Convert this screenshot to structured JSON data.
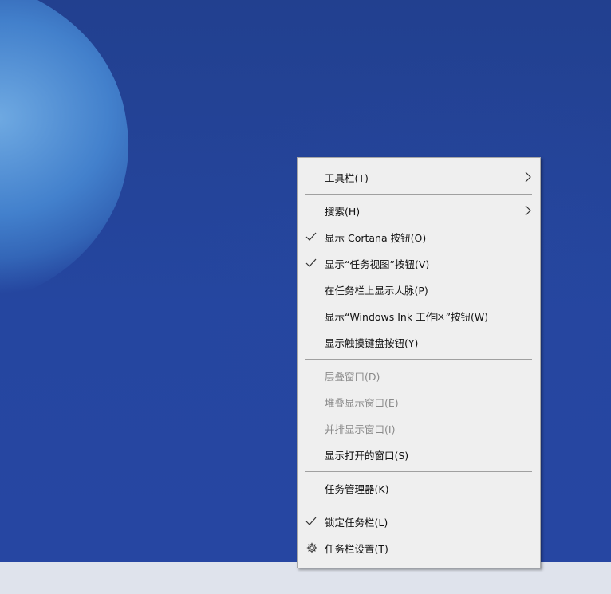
{
  "menu": {
    "toolbars": "工具栏(T)",
    "search": "搜索(H)",
    "show_cortana": "显示 Cortana 按钮(O)",
    "show_task_view": "显示“任务视图”按钮(V)",
    "show_people": "在任务栏上显示人脉(P)",
    "show_ink_workspace": "显示“Windows Ink 工作区”按钮(W)",
    "show_touch_keyboard": "显示触摸键盘按钮(Y)",
    "cascade_windows": "层叠窗口(D)",
    "stack_windows": "堆叠显示窗口(E)",
    "side_by_side": "并排显示窗口(I)",
    "show_desktop": "显示打开的窗口(S)",
    "task_manager": "任务管理器(K)",
    "lock_taskbar": "锁定任务栏(L)",
    "taskbar_settings": "任务栏设置(T)"
  },
  "icons": {
    "submenu": "chevron-right-icon",
    "checked": "checkmark-icon",
    "settings": "gear-icon"
  },
  "colors": {
    "menu_background": "#efefef",
    "desktop_background": "#24439a",
    "disabled_text": "#8a8a8a"
  }
}
